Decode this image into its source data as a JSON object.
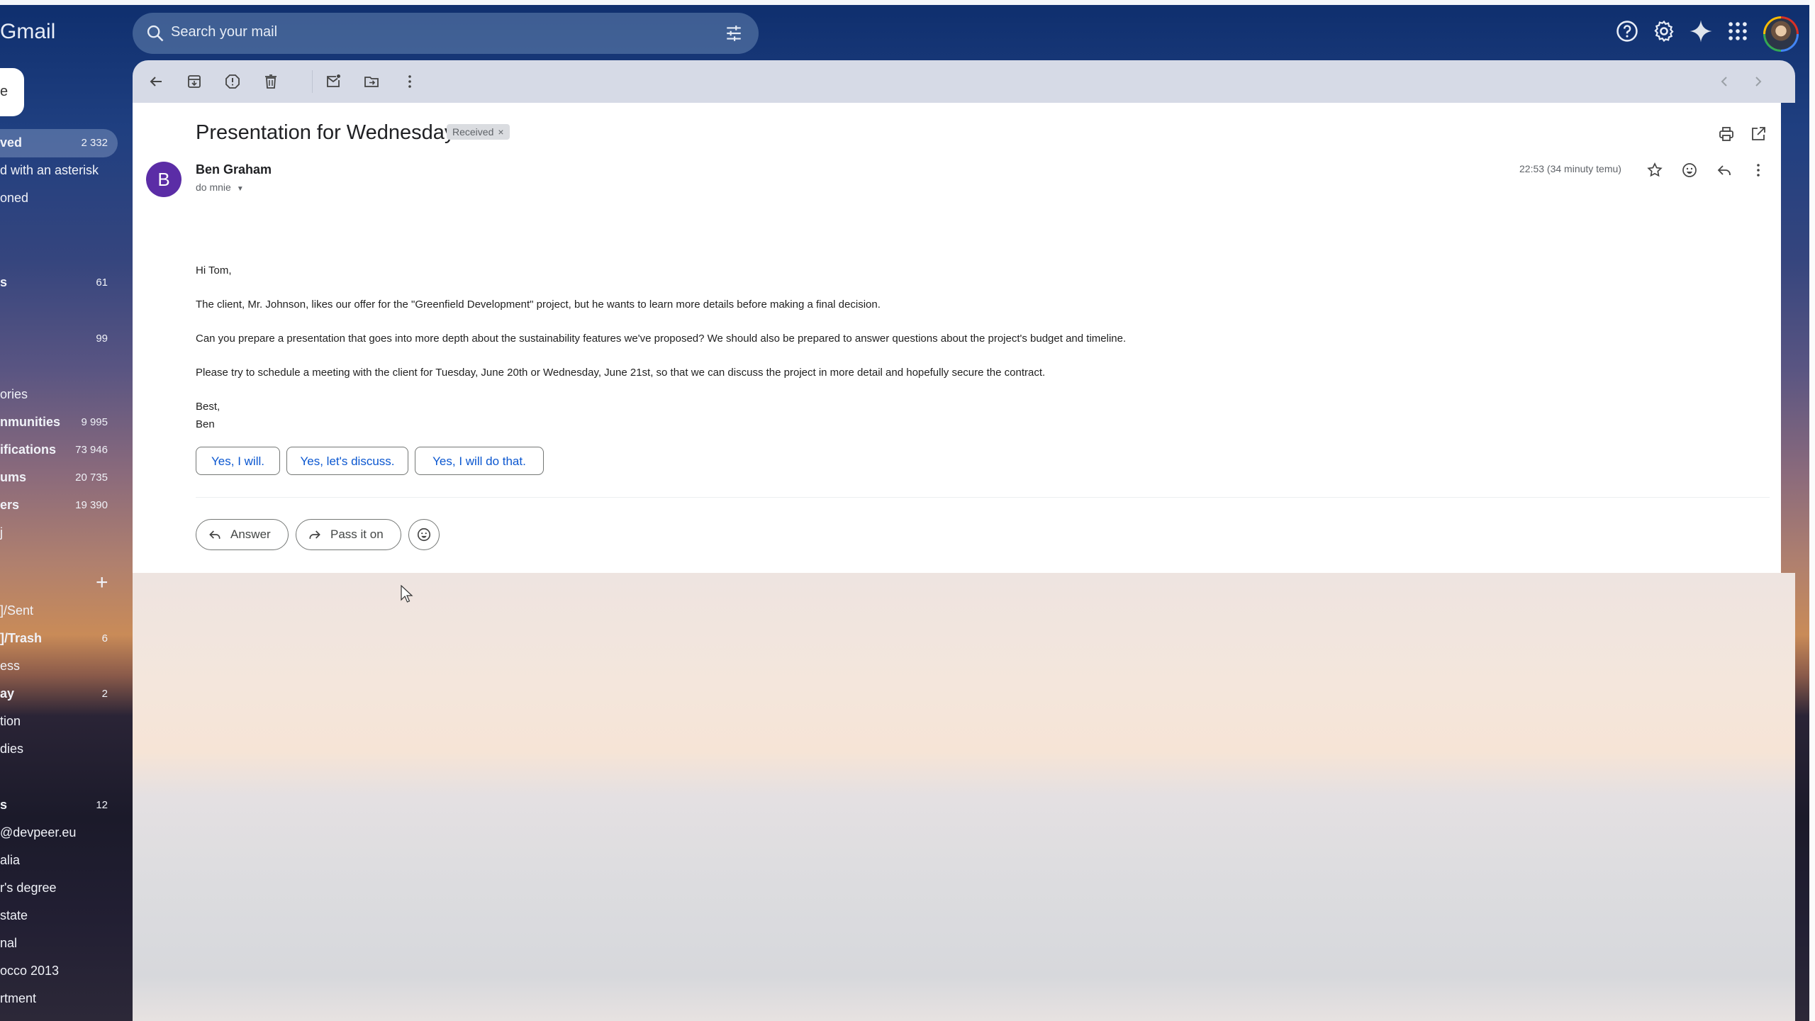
{
  "app": {
    "title": "Gmail"
  },
  "search": {
    "placeholder": "Search your mail"
  },
  "header_icons": [
    "help-icon",
    "settings-icon",
    "gemini-sparkle-icon",
    "apps-grid-icon",
    "account-avatar"
  ],
  "sidebar": {
    "compose_label": "e",
    "items": [
      {
        "label": "ved",
        "count": "2 332",
        "active": true,
        "bold": true
      },
      {
        "label": "d with an asterisk",
        "count": ""
      },
      {
        "label": "oned",
        "count": ""
      },
      {
        "label": "s",
        "count": "61",
        "bold": true
      },
      {
        "label": "",
        "count": "99"
      },
      {
        "label": "ories",
        "count": ""
      },
      {
        "label": "nmunities",
        "count": "9 995",
        "bold": true
      },
      {
        "label": "ifications",
        "count": "73 946",
        "bold": true
      },
      {
        "label": "ums",
        "count": "20 735",
        "bold": true
      },
      {
        "label": "ers",
        "count": "19 390",
        "bold": true
      },
      {
        "label": "j",
        "count": ""
      },
      {
        "label": "]/Sent",
        "count": ""
      },
      {
        "label": "]/Trash",
        "count": "6",
        "bold": true
      },
      {
        "label": "ess",
        "count": ""
      },
      {
        "label": "ay",
        "count": "2",
        "bold": true
      },
      {
        "label": "tion",
        "count": ""
      },
      {
        "label": "dies",
        "count": ""
      },
      {
        "label": "s",
        "count": "12",
        "bold": true
      },
      {
        "label": "@devpeer.eu",
        "count": ""
      },
      {
        "label": "alia",
        "count": ""
      },
      {
        "label": "r's degree",
        "count": ""
      },
      {
        "label": "state",
        "count": ""
      },
      {
        "label": "nal",
        "count": ""
      },
      {
        "label": "occo 2013",
        "count": ""
      },
      {
        "label": "rtment",
        "count": ""
      }
    ],
    "labels_add": "+"
  },
  "toolbar": {
    "actions": [
      "back",
      "archive",
      "report-spam",
      "delete",
      "mark-unread",
      "move-to",
      "more"
    ]
  },
  "email": {
    "subject": "Presentation for Wednesday",
    "label": "Received",
    "label_remove": "×",
    "sender": {
      "initial": "B",
      "name": "Ben Graham",
      "to": "do mnie",
      "avatar_color": "#5b2da6"
    },
    "timestamp": "22:53 (34 minuty temu)",
    "body": [
      "Hi Tom,",
      "The client, Mr. Johnson, likes our offer for the \"Greenfield Development\" project, but he wants to learn more details before making a final decision.",
      "Can you prepare a presentation that goes into more depth about the sustainability features we've proposed? We should also be prepared to answer questions about the project's budget and timeline.",
      "Please try to schedule a meeting with the client for Tuesday, June 20th or Wednesday, June 21st, so that we can discuss the project in more detail and hopefully secure the contract.",
      "Best,",
      "Ben"
    ],
    "smart_replies": [
      "Yes, I will.",
      "Yes, let's discuss.",
      "Yes, I will do that."
    ],
    "actions": {
      "reply": "Answer",
      "forward": "Pass it on"
    }
  }
}
